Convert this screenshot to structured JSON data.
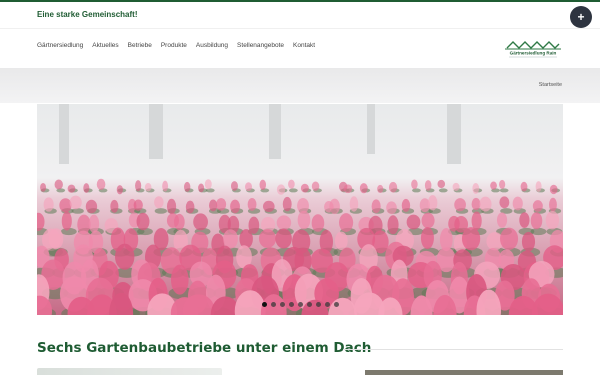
{
  "topbar": {
    "tagline": "Eine starke Gemeinschaft!",
    "plus_label": "+"
  },
  "nav": {
    "items": [
      {
        "label": "Gärtnersiedlung"
      },
      {
        "label": "Aktuelles"
      },
      {
        "label": "Betriebe"
      },
      {
        "label": "Produkte"
      },
      {
        "label": "Ausbildung"
      },
      {
        "label": "Stellenangebote"
      },
      {
        "label": "Kontakt"
      }
    ],
    "logo_text": "Gärtnersiedlung Rain"
  },
  "breadcrumb": {
    "current": "Startseite"
  },
  "slider": {
    "slide_count": 9,
    "active_index": 0,
    "image_icon": "cyclamen-greenhouse-photo"
  },
  "main": {
    "heading": "Sechs Gartenbaubetriebe unter einem Dach"
  },
  "colors": {
    "brand_green": "#1f5c33",
    "dark_button": "#2e3440",
    "flower_pink": "#e26b8f"
  }
}
